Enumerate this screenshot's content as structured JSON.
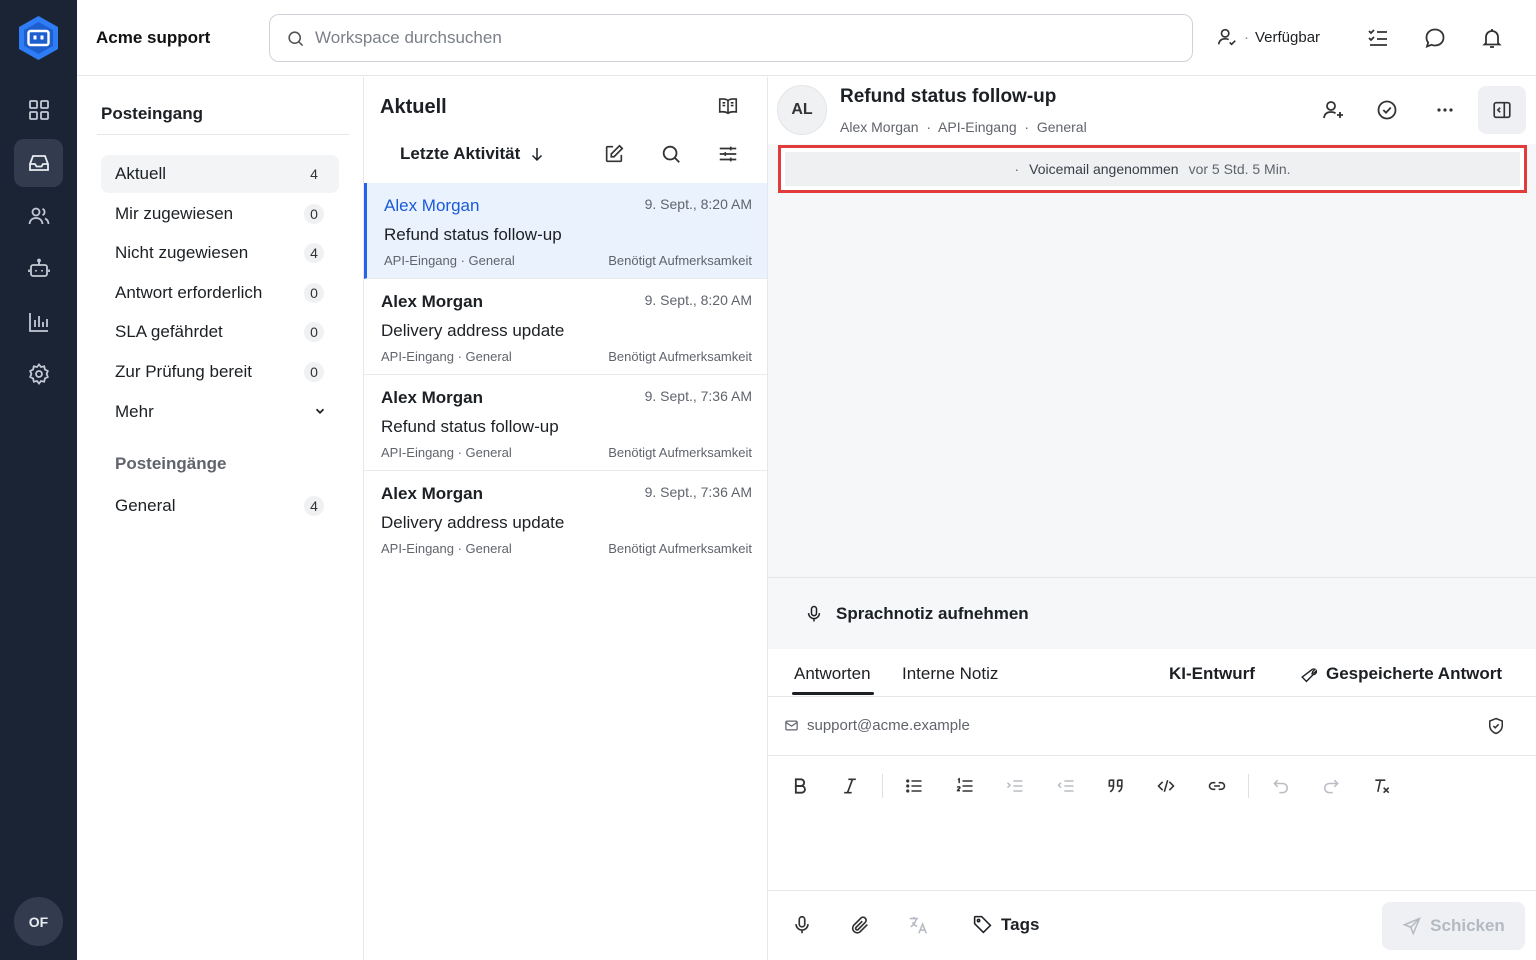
{
  "app": {
    "name": "Acme support",
    "user_initials": "OF"
  },
  "search": {
    "placeholder": "Workspace durchsuchen"
  },
  "status": {
    "label": "Verfügbar"
  },
  "rail": {
    "items": [
      "dashboard-icon",
      "inbox-icon",
      "contacts-icon",
      "bot-icon",
      "reports-icon",
      "settings-icon"
    ],
    "active": "inbox-icon"
  },
  "sidebar": {
    "title": "Posteingang",
    "items": [
      {
        "label": "Aktuell",
        "count": "4"
      },
      {
        "label": "Mir zugewiesen",
        "count": "0"
      },
      {
        "label": "Nicht zugewiesen",
        "count": "4"
      },
      {
        "label": "Antwort erforderlich",
        "count": "0"
      },
      {
        "label": "SLA gefährdet",
        "count": "0"
      },
      {
        "label": "Zur Prüfung bereit",
        "count": "0"
      },
      {
        "label": "Mehr"
      }
    ],
    "section_title": "Posteingänge",
    "inboxes": [
      {
        "label": "General",
        "count": "4"
      }
    ]
  },
  "list": {
    "title": "Aktuell",
    "sort_label": "Letzte Aktivität",
    "conversations": [
      {
        "name": "Alex Morgan",
        "time": "9. Sept., 8:20 AM",
        "subject": "Refund status follow-up",
        "meta": "API-Eingang · General",
        "flag": "Benötigt Aufmerksamkeit"
      },
      {
        "name": "Alex Morgan",
        "time": "9. Sept., 8:20 AM",
        "subject": "Delivery address update",
        "meta": "API-Eingang · General",
        "flag": "Benötigt Aufmerksamkeit"
      },
      {
        "name": "Alex Morgan",
        "time": "9. Sept., 7:36 AM",
        "subject": "Refund status follow-up",
        "meta": "API-Eingang · General",
        "flag": "Benötigt Aufmerksamkeit"
      },
      {
        "name": "Alex Morgan",
        "time": "9. Sept., 7:36 AM",
        "subject": "Delivery address update",
        "meta": "API-Eingang · General",
        "flag": "Benötigt Aufmerksamkeit"
      }
    ]
  },
  "detail": {
    "avatar_initials": "AL",
    "title": "Refund status follow-up",
    "subtitle": "Alex Morgan  ·  API-Eingang  ·  General",
    "activity": {
      "bullet": "·",
      "text": "Voicemail angenommen",
      "time": "vor 5 Std. 5 Min."
    },
    "voice_note_label": "Sprachnotiz aufnehmen"
  },
  "composer": {
    "tabs": {
      "reply": "Antworten",
      "note": "Interne Notiz",
      "ai_draft": "KI-Entwurf",
      "saved_reply": "Gespeicherte Antwort"
    },
    "from": "support@acme.example",
    "tags_label": "Tags",
    "send_label": "Schicken"
  },
  "colors": {
    "rail_bg": "#1b2434",
    "accent": "#2563eb",
    "highlight_border": "#e23b3b"
  }
}
